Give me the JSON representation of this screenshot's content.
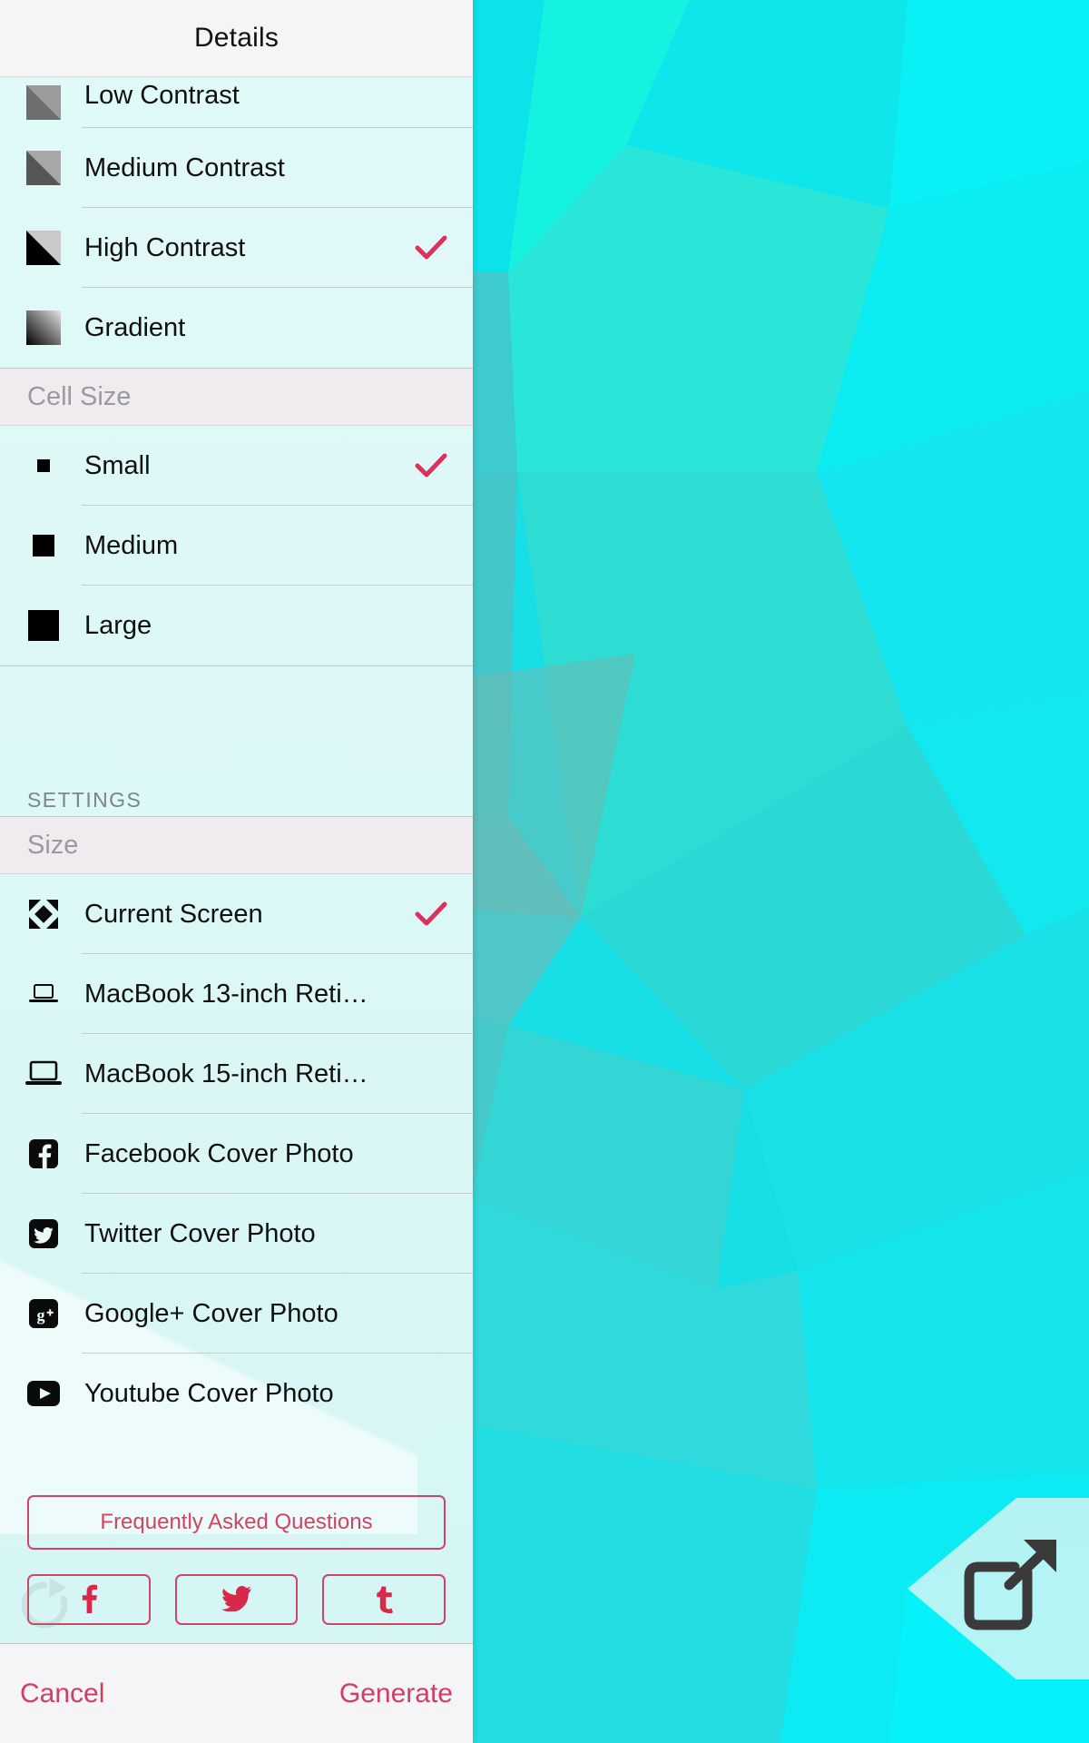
{
  "header": {
    "title": "Details"
  },
  "contrast_section": {
    "items": [
      {
        "label": "Low Contrast",
        "icon": "contrast-low-swatch-icon",
        "checked": false
      },
      {
        "label": "Medium Contrast",
        "icon": "contrast-medium-swatch-icon",
        "checked": false
      },
      {
        "label": "High Contrast",
        "icon": "contrast-high-swatch-icon",
        "checked": true
      },
      {
        "label": "Gradient",
        "icon": "gradient-swatch-icon",
        "checked": false
      }
    ]
  },
  "cell_size_section": {
    "heading": "Cell Size",
    "items": [
      {
        "label": "Small",
        "icon": "square-small-icon",
        "checked": true
      },
      {
        "label": "Medium",
        "icon": "square-medium-icon",
        "checked": false
      },
      {
        "label": "Large",
        "icon": "square-large-icon",
        "checked": false
      }
    ]
  },
  "settings_section": {
    "caption": "SETTINGS",
    "heading": "Size",
    "items": [
      {
        "label": "Current Screen",
        "icon": "expand-arrows-icon",
        "checked": true
      },
      {
        "label": "MacBook 13-inch Reti…",
        "icon": "laptop-small-icon",
        "checked": false
      },
      {
        "label": "MacBook 15-inch Reti…",
        "icon": "laptop-large-icon",
        "checked": false
      },
      {
        "label": "Facebook Cover Photo",
        "icon": "facebook-icon",
        "checked": false
      },
      {
        "label": "Twitter Cover Photo",
        "icon": "twitter-icon",
        "checked": false
      },
      {
        "label": "Google+ Cover Photo",
        "icon": "google-plus-icon",
        "checked": false
      },
      {
        "label": "Youtube Cover Photo",
        "icon": "youtube-icon",
        "checked": false
      }
    ]
  },
  "actions": {
    "faq_label": "Frequently Asked Questions",
    "share_buttons": [
      {
        "name": "share-facebook-button",
        "icon": "facebook-f-icon",
        "glyph": "f"
      },
      {
        "name": "share-twitter-button",
        "icon": "twitter-bird-icon",
        "glyph": ""
      },
      {
        "name": "share-tumblr-button",
        "icon": "tumblr-t-icon",
        "glyph": "t"
      }
    ],
    "reload_icon": "reload-icon"
  },
  "footer": {
    "cancel_label": "Cancel",
    "generate_label": "Generate"
  },
  "canvas": {
    "external_link_icon": "external-link-icon"
  },
  "colors": {
    "accent": "#d23e62",
    "accent_border": "#cf4566",
    "check": "#d8335c",
    "header_bg": "#f6f5f6",
    "section_head_bg": "#efebef",
    "panel_bg": "#e2f9f9",
    "wallpaper_base": "#16dfe8",
    "text": "#101010",
    "muted_text": "#9a9a9e"
  }
}
